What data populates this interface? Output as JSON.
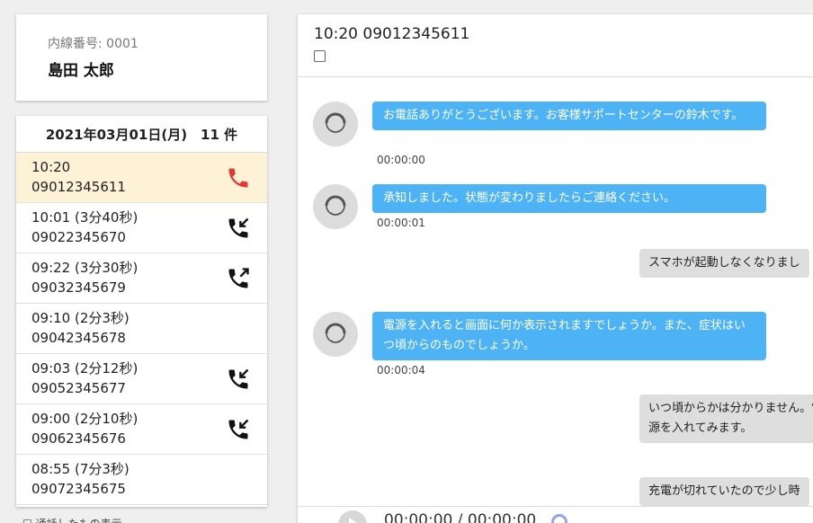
{
  "user": {
    "extension": "内線番号: 0001",
    "name": "島田 太郎"
  },
  "call_list": {
    "header": "2021年03月01日(月)　11 件",
    "items": [
      {
        "time": "10:20",
        "number": "09012345611",
        "icon": "phone-active-icon",
        "active": true
      },
      {
        "time": "10:01 (3分40秒)",
        "number": "09022345670",
        "icon": "incoming-call-icon"
      },
      {
        "time": "09:22 (3分30秒)",
        "number": "09032345679",
        "icon": "outgoing-call-icon"
      },
      {
        "time": "09:10 (2分3秒)",
        "number": "09042345678",
        "icon": ""
      },
      {
        "time": "09:03 (2分12秒)",
        "number": "09052345677",
        "icon": "incoming-call-icon"
      },
      {
        "time": "09:00 (2分10秒)",
        "number": "09062345676",
        "icon": "incoming-call-icon"
      },
      {
        "time": "08:55 (7分3秒)",
        "number": "09072345675",
        "icon": ""
      }
    ]
  },
  "bottom_checkbox_label": "☐ 通話したもの表示",
  "detail": {
    "title": "10:20 09012345611",
    "messages": [
      {
        "side": "left",
        "text": "お電話ありがとうございます。お客様サポートセンターの鈴木です。",
        "time": "00:00:00"
      },
      {
        "side": "left",
        "text": "承知しました。状態が変わりましたらご連絡ください。",
        "time": "00:00:01"
      },
      {
        "side": "right",
        "text": "スマホが起動しなくなりまし"
      },
      {
        "side": "left",
        "text": "電源を入れると画面に何か表示されますでしょうか。また、症状はいつ頃からのものでしょうか。",
        "time": "00:00:04"
      },
      {
        "side": "right",
        "text": "いつ頃からかは分かりません。電源を入れてみます。"
      },
      {
        "side": "right",
        "text": "充電が切れていたので少し時"
      }
    ]
  },
  "player": {
    "time": "00:00:00 / 00:00:00"
  },
  "colors": {
    "accent_blue": "#4db3f5",
    "active_row": "#fdf1d6",
    "phone_red": "#e53935"
  }
}
